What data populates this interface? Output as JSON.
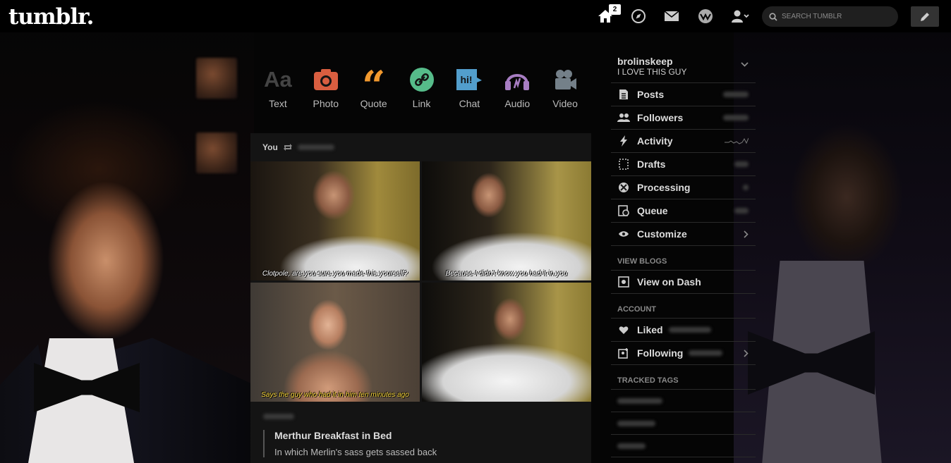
{
  "header": {
    "logo": "tumblr.",
    "notification_count": "2",
    "search_placeholder": "SEARCH TUMBLR",
    "icons": [
      "home-icon",
      "explore-icon",
      "inbox-icon",
      "activity-icon",
      "account-icon",
      "compose-icon"
    ]
  },
  "post_types": [
    {
      "label": "Text",
      "icon": "text-icon",
      "color": "#444444"
    },
    {
      "label": "Photo",
      "icon": "camera-icon",
      "color": "#d95e40"
    },
    {
      "label": "Quote",
      "icon": "quote-icon",
      "color": "#f2992e"
    },
    {
      "label": "Link",
      "icon": "link-icon",
      "color": "#56bc8a"
    },
    {
      "label": "Chat",
      "icon": "chat-icon",
      "color": "#529ecc"
    },
    {
      "label": "Audio",
      "icon": "headphones-icon",
      "color": "#a77dc2"
    },
    {
      "label": "Video",
      "icon": "video-camera-icon",
      "color": "#748089"
    }
  ],
  "post": {
    "author": "You",
    "captions": [
      "Clotpole, are you sure you made this yourself?",
      "Because I didn't know you had it in you",
      "Says the guy who had it in him ten minutes ago",
      ""
    ],
    "title": "Merthur Breakfast in Bed",
    "summary": "In which Merlin's sass gets sassed back"
  },
  "sidebar": {
    "blog_name": "brolinskeep",
    "blog_title": "I LOVE THIS GUY",
    "items": [
      {
        "label": "Posts",
        "icon": "posts-icon"
      },
      {
        "label": "Followers",
        "icon": "followers-icon"
      },
      {
        "label": "Activity",
        "icon": "lightning-icon"
      },
      {
        "label": "Drafts",
        "icon": "drafts-icon"
      },
      {
        "label": "Processing",
        "icon": "processing-icon"
      },
      {
        "label": "Queue",
        "icon": "queue-icon"
      },
      {
        "label": "Customize",
        "icon": "eye-icon"
      }
    ],
    "view_blogs_heading": "VIEW BLOGS",
    "view_on_dash": "View on Dash",
    "account_heading": "ACCOUNT",
    "liked": "Liked",
    "following": "Following",
    "tracked_tags_heading": "TRACKED TAGS"
  },
  "colors": {
    "background": "#000000",
    "panel": "#141414",
    "accent_badge": "#ffffff",
    "caption_white": "#ffffff",
    "caption_yellow": "#f5d43a"
  }
}
